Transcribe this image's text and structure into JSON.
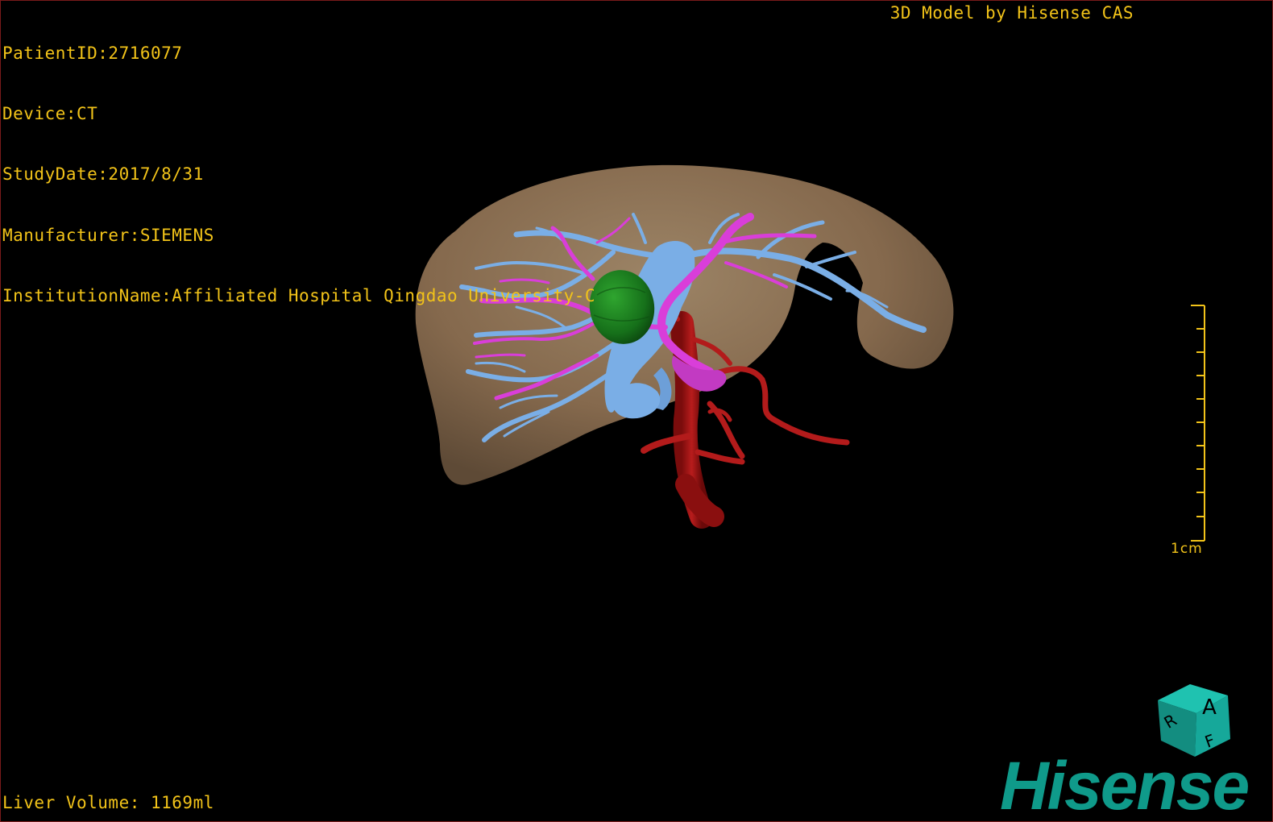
{
  "header": {
    "patient_id": "PatientID:2716077",
    "device": "Device:CT",
    "study_date": "StudyDate:2017/8/31",
    "manufacturer": "Manufacturer:SIEMENS",
    "institution": "InstitutionName:Affiliated Hospital Qingdao University-C"
  },
  "credit": "3D Model by Hisense CAS",
  "footer": {
    "liver_volume": "Liver Volume: 1169ml"
  },
  "scale_bar": {
    "label": "1cm"
  },
  "orientation_cube": {
    "faces": [
      "A",
      "R",
      "F"
    ]
  },
  "brand": {
    "logo_text": "Hisense"
  },
  "colors": {
    "overlay_text": "#f2c319",
    "liver": "#8c7458",
    "portal_vein": "#7aaee6",
    "hepatic_vein": "#d93ed9",
    "tumor": "#1f7a1f",
    "artery": "#b31515",
    "brand": "#0f9a8a",
    "cube": "#16a89a"
  }
}
